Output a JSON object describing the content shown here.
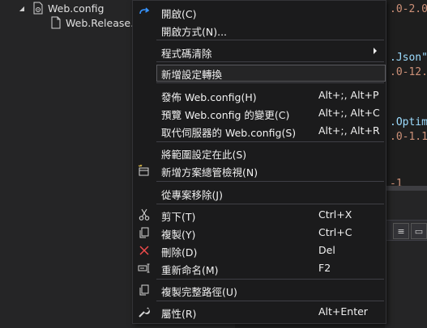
{
  "solution_explorer": {
    "items": [
      {
        "label": "Web.config",
        "icon": "config-file-icon",
        "expanded": true
      },
      {
        "label": "Web.Release.c",
        "icon": "config-file-icon"
      }
    ]
  },
  "editor": {
    "lines": [
      {
        "text": ".0-2.0",
        "kind": "str"
      },
      {
        "text": ".Json\"",
        "kind": "prop"
      },
      {
        "text": ".0-12.",
        "kind": "str"
      },
      {
        "text": ".Optim",
        "kind": "prop"
      },
      {
        "text": ".0-1.1",
        "kind": "str"
      },
      {
        "text": "   -1",
        "kind": "str"
      }
    ]
  },
  "context_menu": {
    "items": [
      {
        "id": "open",
        "label": "開啟(C)",
        "icon": "navigate-arrow-icon",
        "shortcut": ""
      },
      {
        "id": "open-with",
        "label": "開啟方式(N)...",
        "icon": "",
        "shortcut": ""
      },
      {
        "id": "code-cleanup",
        "label": "程式碼清除",
        "icon": "",
        "shortcut": "",
        "submenu": true
      },
      {
        "id": "add-config-transform",
        "label": "新增設定轉換",
        "icon": "",
        "shortcut": "",
        "highlighted": true
      },
      {
        "id": "publish-webconfig",
        "label": "發佈 Web.config(H)",
        "icon": "",
        "shortcut": "Alt+;, Alt+P"
      },
      {
        "id": "preview-webconfig",
        "label": "預覽 Web.config 的變更(C)",
        "icon": "",
        "shortcut": "Alt+;, Alt+C"
      },
      {
        "id": "replace-server-webconfig",
        "label": "取代伺服器的 Web.config(S)",
        "icon": "",
        "shortcut": "Alt+;, Alt+R"
      },
      {
        "id": "scope-to-this",
        "label": "將範圍設定在此(S)",
        "icon": "",
        "shortcut": ""
      },
      {
        "id": "new-solution-view",
        "label": "新增方案總管檢視(N)",
        "icon": "new-view-icon",
        "shortcut": ""
      },
      {
        "id": "exclude-from-project",
        "label": "從專案移除(J)",
        "icon": "",
        "shortcut": ""
      },
      {
        "id": "cut",
        "label": "剪下(T)",
        "icon": "scissors-icon",
        "shortcut": "Ctrl+X"
      },
      {
        "id": "copy",
        "label": "複製(Y)",
        "icon": "copy-icon",
        "shortcut": "Ctrl+C"
      },
      {
        "id": "delete",
        "label": "刪除(D)",
        "icon": "delete-x-icon",
        "shortcut": "Del"
      },
      {
        "id": "rename",
        "label": "重新命名(M)",
        "icon": "rename-icon",
        "shortcut": "F2"
      },
      {
        "id": "copy-full-path",
        "label": "複製完整路徑(U)",
        "icon": "copy-icon",
        "shortcut": ""
      },
      {
        "id": "properties",
        "label": "屬性(R)",
        "icon": "wrench-icon",
        "shortcut": "Alt+Enter"
      }
    ]
  },
  "colors": {
    "menu_bg": "#1b1b1c",
    "menu_text": "#f1f1f1",
    "separator": "#3f3f46",
    "accent_blue": "#3794ff",
    "delete_red": "#f14c4c"
  }
}
